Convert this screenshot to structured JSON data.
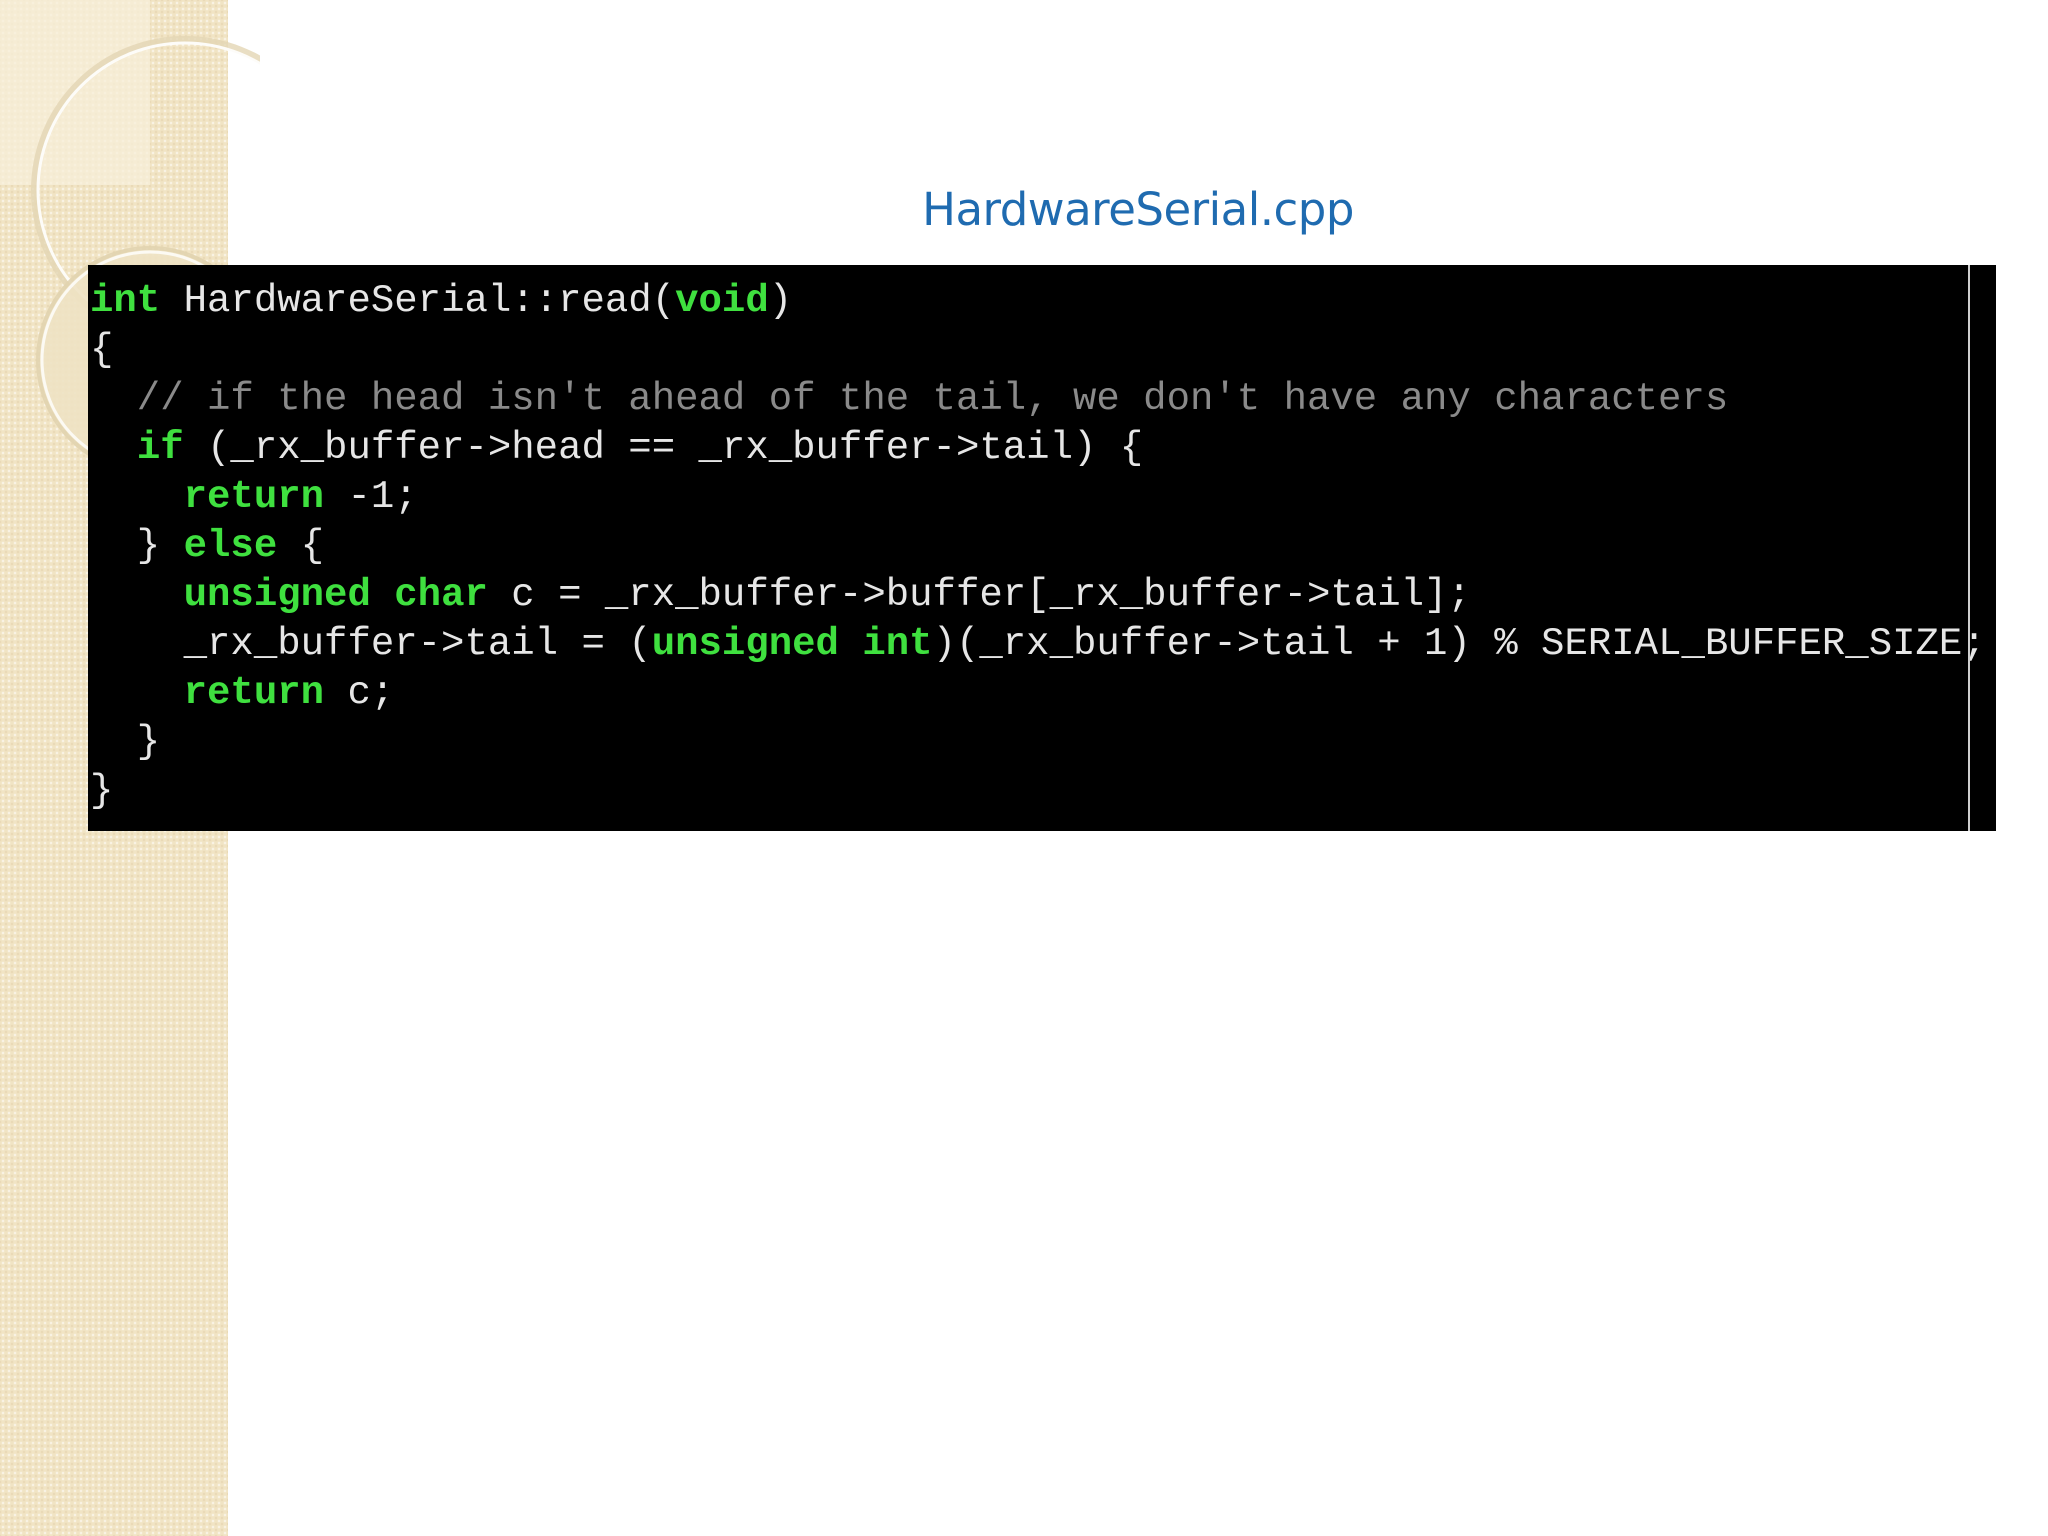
{
  "slide": {
    "title": "HardwareSerial.cpp"
  },
  "code": {
    "language": "cpp",
    "lines": [
      [
        {
          "t": "int",
          "k": "kw"
        },
        {
          "t": " HardwareSerial::read"
        },
        {
          "t": "("
        },
        {
          "t": "void",
          "k": "kw"
        },
        {
          "t": ")"
        }
      ],
      [
        {
          "t": "{"
        }
      ],
      [
        {
          "t": "  // if the head isn't ahead of the tail, we don't have any characters",
          "k": "cm"
        }
      ],
      [
        {
          "t": "  "
        },
        {
          "t": "if",
          "k": "kw"
        },
        {
          "t": " (_rx_buffer->head == _rx_buffer->tail) {"
        }
      ],
      [
        {
          "t": "    "
        },
        {
          "t": "return",
          "k": "kw"
        },
        {
          "t": " -1;"
        }
      ],
      [
        {
          "t": "  } "
        },
        {
          "t": "else",
          "k": "kw"
        },
        {
          "t": " {"
        }
      ],
      [
        {
          "t": "    "
        },
        {
          "t": "unsigned char",
          "k": "kw"
        },
        {
          "t": " c = _rx_buffer->buffer[_rx_buffer->tail];"
        }
      ],
      [
        {
          "t": "    _rx_buffer->tail = ("
        },
        {
          "t": "unsigned int",
          "k": "kw"
        },
        {
          "t": ")(_rx_buffer->tail + 1) % SERIAL_BUFFER_SIZE;"
        }
      ],
      [
        {
          "t": "    "
        },
        {
          "t": "return",
          "k": "kw"
        },
        {
          "t": " c;"
        }
      ],
      [
        {
          "t": "  }"
        }
      ],
      [
        {
          "t": "}"
        }
      ]
    ]
  },
  "colors": {
    "title": "#1f6bb0",
    "keyword": "#3fe03f",
    "comment": "#8a8a8a",
    "code_text": "#e6e6e6",
    "code_background": "#000000",
    "sidebar": "#f1e4c4"
  }
}
